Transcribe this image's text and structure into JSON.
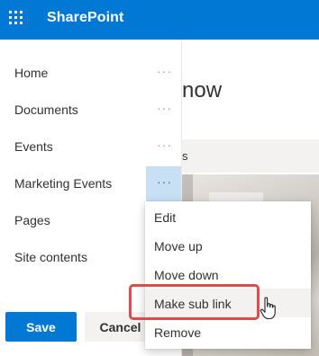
{
  "suitebar": {
    "brand": "SharePoint",
    "waffle_icon": "app-launcher-icon",
    "color": "#0078d4"
  },
  "background": {
    "title_fragment": "now",
    "bar_fragment": "s"
  },
  "nav": {
    "items": [
      {
        "label": "Home"
      },
      {
        "label": "Documents"
      },
      {
        "label": "Events"
      },
      {
        "label": "Marketing Events"
      },
      {
        "label": "Pages"
      },
      {
        "label": "Site contents"
      }
    ],
    "more_glyph": "···"
  },
  "actions": {
    "save_label": "Save",
    "cancel_label": "Cancel"
  },
  "context_menu": {
    "items": [
      {
        "label": "Edit"
      },
      {
        "label": "Move up"
      },
      {
        "label": "Move down"
      },
      {
        "label": "Make sub link"
      },
      {
        "label": "Remove"
      }
    ],
    "highlighted_item": "Make sub link",
    "highlight_color": "#e04a4a"
  }
}
